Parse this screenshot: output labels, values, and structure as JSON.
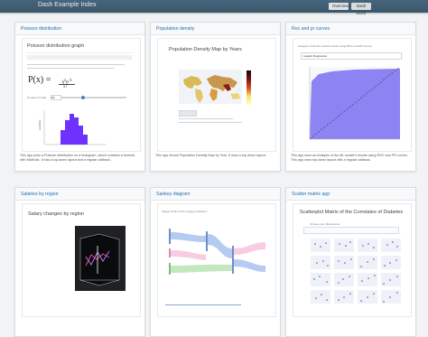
{
  "header": {
    "title": "Dash Example Index",
    "overview_label": "Overview",
    "dash_docs_label": "Dash Docs",
    "accent": "#415d74"
  },
  "cards": [
    {
      "title": "Poisson distribution",
      "preview_title": "Poisson distribution graph",
      "description": "This app plots a Poisson distribution on a histogram, which contains a formula with MathJax. It has a top-down layout and a regular callback.",
      "formula": "P(x) =",
      "input_label": "Number of trials",
      "icon": "histogram-icon"
    },
    {
      "title": "Population density",
      "preview_title": "Population Density Map by Years",
      "description": "This app shows Population Density Map by Year. It uses a top-down layout.",
      "icon": "map-icon"
    },
    {
      "title": "Roc and pr curves",
      "preview_title": "Analysis of the ML model's results using ROC and PR Curves",
      "description": "This app does an Analysis of the ML model's results using ROC and PR curves. This app uses top-down layout with a regular callback.",
      "select_value": "Logistic Regression",
      "icon": "curve-icon"
    },
    {
      "title": "Salaries by region",
      "preview_title": "Salary changes by region",
      "description": "",
      "icon": "bar-chart-icon"
    },
    {
      "title": "Sankey diagram",
      "preview_title": "Supply chain of the energy production",
      "description": "",
      "icon": "sankey-icon"
    },
    {
      "title": "Scatter matrix app",
      "preview_title": "Scatterplot Matrix of the Correlates of Diabetes",
      "description": "",
      "dimensions_label": "Choose your dimensions:",
      "icon": "scatter-matrix-icon"
    }
  ],
  "colors": {
    "purple": "#6f31ff",
    "roc_fill": "#8b84f2",
    "sankey_blue": "#5c8be0",
    "sankey_pink": "#ef8fbf",
    "sankey_green": "#8ccf7f",
    "scatter_blue": "#4d55b8"
  }
}
